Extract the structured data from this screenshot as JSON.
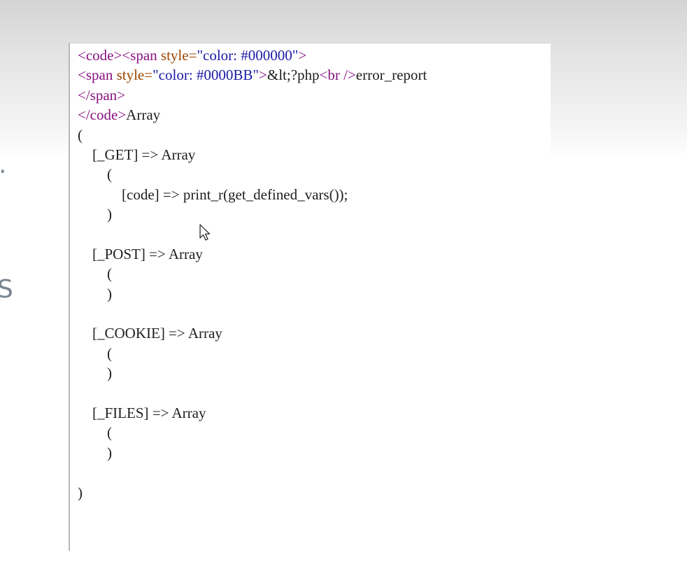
{
  "background": {
    "fragment_top": ".",
    "fragment_s": "S"
  },
  "source_view": {
    "line1": {
      "open_code": "<code>",
      "open_span": "<span ",
      "attr_style": "style=",
      "attr_value": "\"color: #000000\"",
      "close_bracket": ">"
    },
    "line2": {
      "open_span": "<span ",
      "attr_style": "style=",
      "attr_value": "\"color: #0000BB\"",
      "close_bracket": ">",
      "text_lt": "&lt;?php",
      "br_tag": "<br />",
      "text_after": "error_report"
    },
    "line3": {
      "close_span": "</span>"
    },
    "line4": {
      "close_code": "</code>",
      "text_after": "Array"
    },
    "output_lines": [
      "(",
      "    [_GET] => Array",
      "        (",
      "            [code] => print_r(get_defined_vars());",
      "        )",
      "",
      "    [_POST] => Array",
      "        (",
      "        )",
      "",
      "    [_COOKIE] => Array",
      "        (",
      "        )",
      "",
      "    [_FILES] => Array",
      "        (",
      "        )",
      "",
      ")"
    ]
  },
  "colors": {
    "tag": "#881280",
    "attribute": "#994500",
    "value": "#1a1aa6",
    "text": "#1e1e1e"
  },
  "icons": {
    "cursor": "mouse-pointer-icon"
  }
}
